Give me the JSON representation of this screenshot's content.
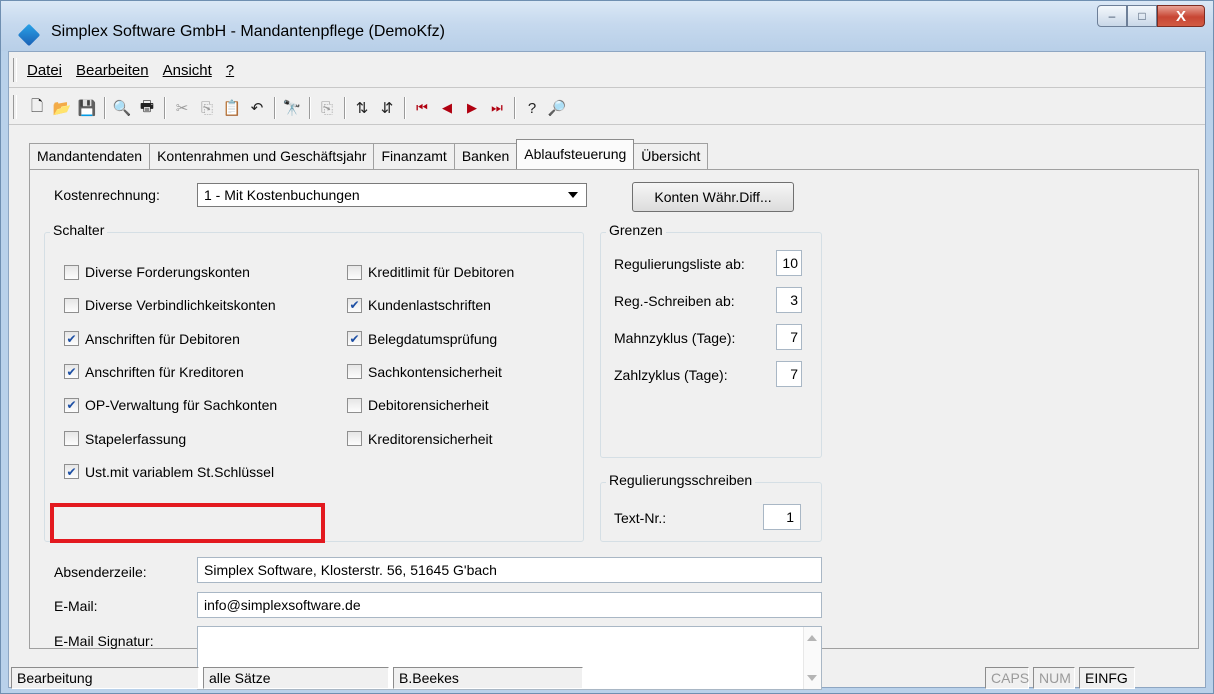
{
  "window": {
    "title": "Simplex Software GmbH - Mandantenpflege (DemoKfz)",
    "controls": {
      "minimize": "–",
      "maximize": "□",
      "close": "X"
    }
  },
  "menu": [
    "Datei",
    "Bearbeiten",
    "Ansicht",
    "?"
  ],
  "toolbar": {
    "buttons": [
      {
        "icon": "new-document-icon",
        "glyph": "🗋"
      },
      {
        "icon": "open-folder-icon",
        "glyph": "📂"
      },
      {
        "icon": "save-icon",
        "glyph": "💾"
      },
      {
        "icon": "print-preview-icon",
        "glyph": "🔍"
      },
      {
        "icon": "print-icon",
        "glyph": "🖶"
      },
      {
        "icon": "cut-icon",
        "glyph": "✂"
      },
      {
        "icon": "copy-icon",
        "glyph": "⎘"
      },
      {
        "icon": "paste-icon",
        "glyph": "📋"
      },
      {
        "icon": "undo-icon",
        "glyph": "↶"
      },
      {
        "icon": "find-icon",
        "glyph": "🔭"
      },
      {
        "icon": "copy-record-icon",
        "glyph": "⎘"
      },
      {
        "icon": "sort-ascending-icon",
        "glyph": "⇅"
      },
      {
        "icon": "sort-descending-icon",
        "glyph": "⇵"
      },
      {
        "icon": "first-record-icon",
        "glyph": "⏮"
      },
      {
        "icon": "previous-record-icon",
        "glyph": "◀"
      },
      {
        "icon": "next-record-icon",
        "glyph": "▶"
      },
      {
        "icon": "last-record-icon",
        "glyph": "⏭"
      },
      {
        "icon": "help-icon",
        "glyph": "?"
      },
      {
        "icon": "info-search-icon",
        "glyph": "🔎"
      }
    ]
  },
  "tabs": [
    {
      "label": "Mandantendaten",
      "active": false
    },
    {
      "label": "Kontenrahmen und Geschäftsjahr",
      "active": false
    },
    {
      "label": "Finanzamt",
      "active": false
    },
    {
      "label": "Banken",
      "active": false
    },
    {
      "label": "Ablaufsteuerung",
      "active": true
    },
    {
      "label": "Übersicht",
      "active": false
    }
  ],
  "kostenrechnung": {
    "label": "Kostenrechnung:",
    "value": "1 - Mit Kostenbuchungen"
  },
  "konten_button": "Konten Währ.Diff...",
  "schalter": {
    "title": "Schalter",
    "left": [
      {
        "label": "Diverse Forderungskonten",
        "checked": false
      },
      {
        "label": "Diverse Verbindlichkeitskonten",
        "checked": false
      },
      {
        "label": "Anschriften für Debitoren",
        "checked": true
      },
      {
        "label": "Anschriften für Kreditoren",
        "checked": true
      },
      {
        "label": "OP-Verwaltung für Sachkonten",
        "checked": true
      },
      {
        "label": "Stapelerfassung",
        "checked": false
      },
      {
        "label": "Ust.mit variablem St.Schlüssel",
        "checked": true
      }
    ],
    "right": [
      {
        "label": "Kreditlimit für Debitoren",
        "checked": false
      },
      {
        "label": "Kundenlastschriften",
        "checked": true
      },
      {
        "label": "Belegdatumsprüfung",
        "checked": true
      },
      {
        "label": "Sachkontensicherheit",
        "checked": false
      },
      {
        "label": "Debitorensicherheit",
        "checked": false
      },
      {
        "label": "Kreditorensicherheit",
        "checked": false
      }
    ]
  },
  "grenzen": {
    "title": "Grenzen",
    "rows": [
      {
        "label": "Regulierungsliste ab:",
        "value": "10"
      },
      {
        "label": "Reg.-Schreiben ab:",
        "value": "3"
      },
      {
        "label": "Mahnzyklus (Tage):",
        "value": "7"
      },
      {
        "label": "Zahlzyklus (Tage):",
        "value": "7"
      }
    ]
  },
  "regulierungsschreiben": {
    "title": "Regulierungsschreiben",
    "label": "Text-Nr.:",
    "value": "1"
  },
  "absender": {
    "label": "Absenderzeile:",
    "value": "Simplex Software, Klosterstr. 56, 51645 G'bach"
  },
  "email": {
    "label": "E-Mail:",
    "value": "info@simplexsoftware.de"
  },
  "signatur": {
    "label": "E-Mail Signatur:",
    "value": ""
  },
  "status": {
    "mode": "Bearbeitung",
    "filter": "alle Sätze",
    "user": "B.Beekes",
    "caps": "CAPS",
    "num": "NUM",
    "einfg": "EINFG"
  },
  "colors": {
    "highlight": "#e3191f",
    "check": "#1d4fa4"
  }
}
